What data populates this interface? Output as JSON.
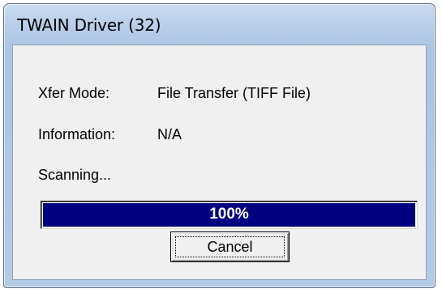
{
  "window": {
    "title": "TWAIN Driver (32)"
  },
  "fields": {
    "xfer_mode_label": "Xfer Mode:",
    "xfer_mode_value": "File Transfer (TIFF File)",
    "information_label": "Information:",
    "information_value": "N/A"
  },
  "status_text": "Scanning...",
  "progress": {
    "value": 100,
    "label": "100%",
    "fill_color": "#000080"
  },
  "buttons": {
    "cancel_label": "Cancel"
  },
  "colors": {
    "frame": "#b7cde8",
    "client_background": "#f0f0f0"
  }
}
